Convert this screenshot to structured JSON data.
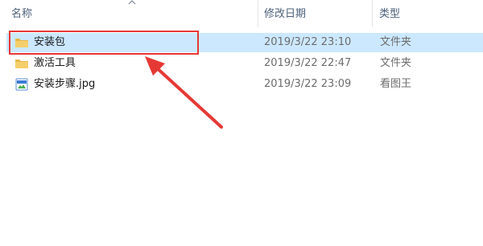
{
  "columns": {
    "name": "名称",
    "date": "修改日期",
    "type": "类型"
  },
  "rows": [
    {
      "name": "安装包",
      "date": "2019/3/22 23:10",
      "type": "文件夹",
      "icon": "folder-icon",
      "selected": true
    },
    {
      "name": "激活工具",
      "date": "2019/3/22 22:47",
      "type": "文件夹",
      "icon": "folder-icon",
      "selected": false
    },
    {
      "name": "安装步骤.jpg",
      "date": "2019/3/22 23:09",
      "type": "看图王 ",
      "icon": "image-file-icon",
      "selected": false
    }
  ],
  "colors": {
    "selection": "#cce8ff",
    "highlight_box": "#e53935",
    "arrow": "#e53935",
    "folder": "#e8b84a"
  }
}
